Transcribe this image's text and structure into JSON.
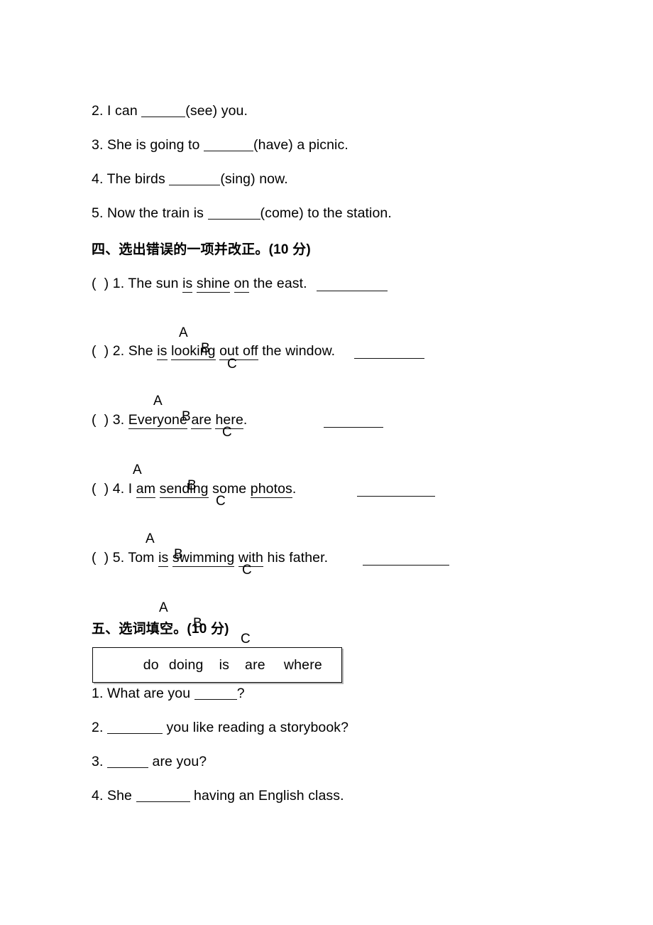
{
  "document": {
    "type": "english-exam-worksheet",
    "page_background": "#ffffff",
    "text_color": "#000000"
  },
  "verb_fill_section": {
    "items": [
      {
        "number": "2.",
        "before": "I can ",
        "blank_width": 62,
        "after": "(see) you."
      },
      {
        "number": "3.",
        "before": "She is going to ",
        "blank_width": 70,
        "after": "(have) a picnic."
      },
      {
        "number": "4.",
        "before": "The birds ",
        "blank_width": 72,
        "after": "(sing) now."
      },
      {
        "number": "5.",
        "before": "Now the train is ",
        "blank_width": 74,
        "after": "(come) to the station."
      }
    ]
  },
  "section_four": {
    "heading": "四、选出错误的一项并改正。(10 分)",
    "questions": [
      {
        "bracket": "(  ) ",
        "number": "1. ",
        "parts": [
          {
            "text": "The sun ",
            "underline": false
          },
          {
            "text": "is",
            "underline": true
          },
          {
            "text": " ",
            "underline": false
          },
          {
            "text": "shine",
            "underline": true
          },
          {
            "text": " ",
            "underline": false
          },
          {
            "text": "on",
            "underline": true
          },
          {
            "text": " the east.",
            "underline": false
          }
        ],
        "options": [
          "A",
          "B",
          "C"
        ]
      },
      {
        "bracket": "(  ) ",
        "number": "2. ",
        "parts": [
          {
            "text": "She ",
            "underline": false
          },
          {
            "text": "is",
            "underline": true
          },
          {
            "text": " ",
            "underline": false
          },
          {
            "text": "looking",
            "underline": true
          },
          {
            "text": " ",
            "underline": false
          },
          {
            "text": "out off",
            "underline": true
          },
          {
            "text": " the window.",
            "underline": false
          }
        ],
        "options": [
          "A",
          "B",
          "C"
        ]
      },
      {
        "bracket": "(  ) ",
        "number": "3. ",
        "parts": [
          {
            "text": "Everyone",
            "underline": true
          },
          {
            "text": " ",
            "underline": false
          },
          {
            "text": "are",
            "underline": true
          },
          {
            "text": " ",
            "underline": false
          },
          {
            "text": "here",
            "underline": true
          },
          {
            "text": ".",
            "underline": false
          }
        ],
        "options": [
          "A",
          "B",
          "C"
        ]
      },
      {
        "bracket": "(  ) ",
        "number": "4. ",
        "parts": [
          {
            "text": "I ",
            "underline": false
          },
          {
            "text": "am",
            "underline": true
          },
          {
            "text": " ",
            "underline": false
          },
          {
            "text": "sending",
            "underline": true
          },
          {
            "text": " some ",
            "underline": false
          },
          {
            "text": "photos",
            "underline": true
          },
          {
            "text": ".",
            "underline": false
          }
        ],
        "options": [
          "A",
          "B",
          "C"
        ]
      },
      {
        "bracket": "(  ) ",
        "number": "5. ",
        "parts": [
          {
            "text": "Tom ",
            "underline": false
          },
          {
            "text": "is",
            "underline": true
          },
          {
            "text": " ",
            "underline": false
          },
          {
            "text": "swimming",
            "underline": true
          },
          {
            "text": " ",
            "underline": false
          },
          {
            "text": "with",
            "underline": true
          },
          {
            "text": " his father.",
            "underline": false
          }
        ],
        "options": [
          "A",
          "B",
          "C"
        ]
      }
    ]
  },
  "section_five": {
    "heading": "五、选词填空。(10 分)",
    "word_bank": [
      "do",
      "doing",
      "is",
      "are",
      "where"
    ],
    "items": [
      {
        "number": "1.",
        "before": "What are you ",
        "blank_width": 60,
        "after": "?"
      },
      {
        "number": "2.",
        "before": "",
        "blank_width": 78,
        "after": " you like reading a storybook?"
      },
      {
        "number": "3.",
        "before": "",
        "blank_width": 58,
        "after": " are you?"
      },
      {
        "number": "4.",
        "before": "She ",
        "blank_width": 76,
        "after": " having an English class."
      }
    ]
  }
}
